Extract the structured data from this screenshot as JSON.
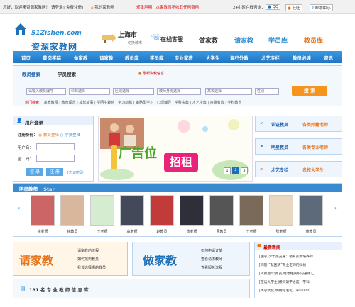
{
  "topbar": {
    "welcome": "您好，欢迎来资源家教网！[请登录][免费注册]",
    "home_link": "我的家教网",
    "notice": "郑重声明：本家教网不收取任何费用",
    "hours": "24小时在线咨询：",
    "qq": "QQ",
    "wangwang": "旺旺",
    "help": "帮助中心"
  },
  "header": {
    "logo_url": "51Zishen.com",
    "logo_name": "资深家教网",
    "city": "上海市",
    "city_switch": "切换城市",
    "online_tutor": "在线客服",
    "buttons": [
      "做家教",
      "请家教",
      "学员库",
      "教员库"
    ],
    "button_colors": [
      "#333333",
      "#2c8bd2",
      "#2c8bd2",
      "#e8761d"
    ]
  },
  "nav": {
    "items": [
      "首页",
      "黄岗学踪",
      "做家教",
      "请家教",
      "教员库",
      "学员库",
      "专业家教",
      "大学生",
      "海归外教",
      "才艺专栏",
      "教员必读",
      "资讯"
    ]
  },
  "search": {
    "tabs": [
      "教员搜索",
      "学员搜索"
    ],
    "hint": "最新资教信息：",
    "teacher_no_placeholder": "请输入教员编号",
    "subject": "科目选择",
    "area": "区域选择",
    "identity": "教师身份选择",
    "school": "高校选择",
    "gender": "性别",
    "button": "搜 索",
    "hot_label": "热门搜索：",
    "hot_items": [
      "家教教程",
      "教育理念",
      "成长故事",
      "学困生转化",
      "学习动机",
      "策略型学习",
      "心理辅导",
      "学科宝典",
      "才艺宝典",
      "容易有效",
      "学科教育"
    ]
  },
  "login": {
    "title": "用户登录",
    "type_label": "注册身份：",
    "type_teacher": "教员登陆",
    "type_student": "学员登陆",
    "username_label": "用户名：",
    "password_label": "密　码：",
    "login_button": "登 录",
    "register_button": "注 册",
    "forgot": "[忘记密码]"
  },
  "banner": {
    "main_text": "广告位",
    "sub_text": "招租",
    "pages": [
      "1",
      "2",
      "3"
    ]
  },
  "side_links": [
    {
      "left": "认证教员",
      "right": "各类外籍老师"
    },
    {
      "left": "明星教员",
      "right": "各类专业老师"
    },
    {
      "left": "才艺专栏",
      "right": "名校大学生"
    }
  ],
  "teachers": {
    "title": "明星教师",
    "title_sub": "Star",
    "names": [
      "钱老师",
      "钱教员",
      "王老师",
      "章老师",
      "赵教员",
      "张老师",
      "曹教员",
      "王老师",
      "张老师",
      "黄教员"
    ]
  },
  "bottom": {
    "left_big": "请家教",
    "left_items": [
      "请家教的流程",
      "如何找到教员",
      "我该选择哪的教员"
    ],
    "mid_big": "做家教",
    "mid_items": [
      "如何申请订单",
      "查看请求教师",
      "查看服务流程"
    ]
  },
  "news": {
    "title": "最新新闻",
    "items": [
      "[国学]少年热充导：箱育知此培养的",
      "[问答]“就医精”专业老师的辩析",
      "[人教版/公务员]给考相关职的通用汇",
      "[在读大学生]被新兼学进度，学科",
      "[大学文化]明确标准化，学科020"
    ]
  },
  "count": {
    "text": "181 名 专 业 教 师 信 息 库"
  },
  "colors": {
    "nav_blue": "#2a86d2",
    "brand_orange": "#f7941d",
    "notice_red": "#e00000"
  }
}
